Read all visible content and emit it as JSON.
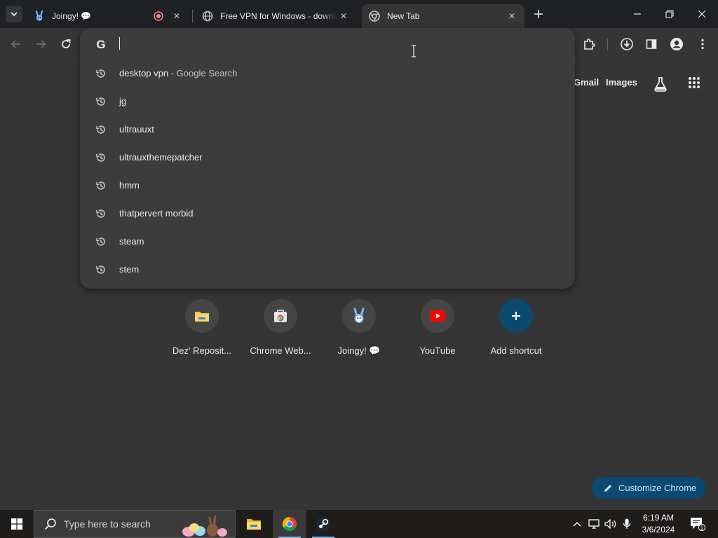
{
  "tabs": [
    {
      "title": "Joingy! 💬",
      "favicon": "joingy-bunny-icon",
      "recording": true
    },
    {
      "title": "Free VPN for Windows - download",
      "favicon": "globe-icon"
    },
    {
      "title": "New Tab",
      "favicon": "chrome-icon",
      "active": true
    }
  ],
  "omnibox": {
    "value": "",
    "engine_icon": "G",
    "suggestions": [
      {
        "text": "desktop vpn",
        "sub": " - Google Search"
      },
      {
        "text": "jg",
        "sub": ""
      },
      {
        "text": "ultrauuxt",
        "sub": ""
      },
      {
        "text": "ultrauxthemepatcher",
        "sub": ""
      },
      {
        "text": "hmm",
        "sub": ""
      },
      {
        "text": "thatpervert morbid",
        "sub": ""
      },
      {
        "text": "steam",
        "sub": ""
      },
      {
        "text": "stem",
        "sub": ""
      }
    ]
  },
  "ntp": {
    "gmail": "Gmail",
    "images": "Images",
    "shortcuts": [
      {
        "label": "Dez' Reposit...",
        "icon": "folder-icon"
      },
      {
        "label": "Chrome Web...",
        "icon": "chrome-web-store-icon"
      },
      {
        "label": "Joingy! 💬",
        "icon": "joingy-bunny-icon"
      },
      {
        "label": "YouTube",
        "icon": "youtube-icon"
      },
      {
        "label": "Add shortcut",
        "icon": "plus-icon"
      }
    ],
    "customize": "Customize Chrome"
  },
  "taskbar": {
    "search_placeholder": "Type here to search",
    "time": "6:19 AM",
    "date": "3/6/2024",
    "notifications": "1"
  },
  "colors": {
    "accent": "#0b4a6f",
    "background": "#353535",
    "youtube": "#ff0000"
  }
}
